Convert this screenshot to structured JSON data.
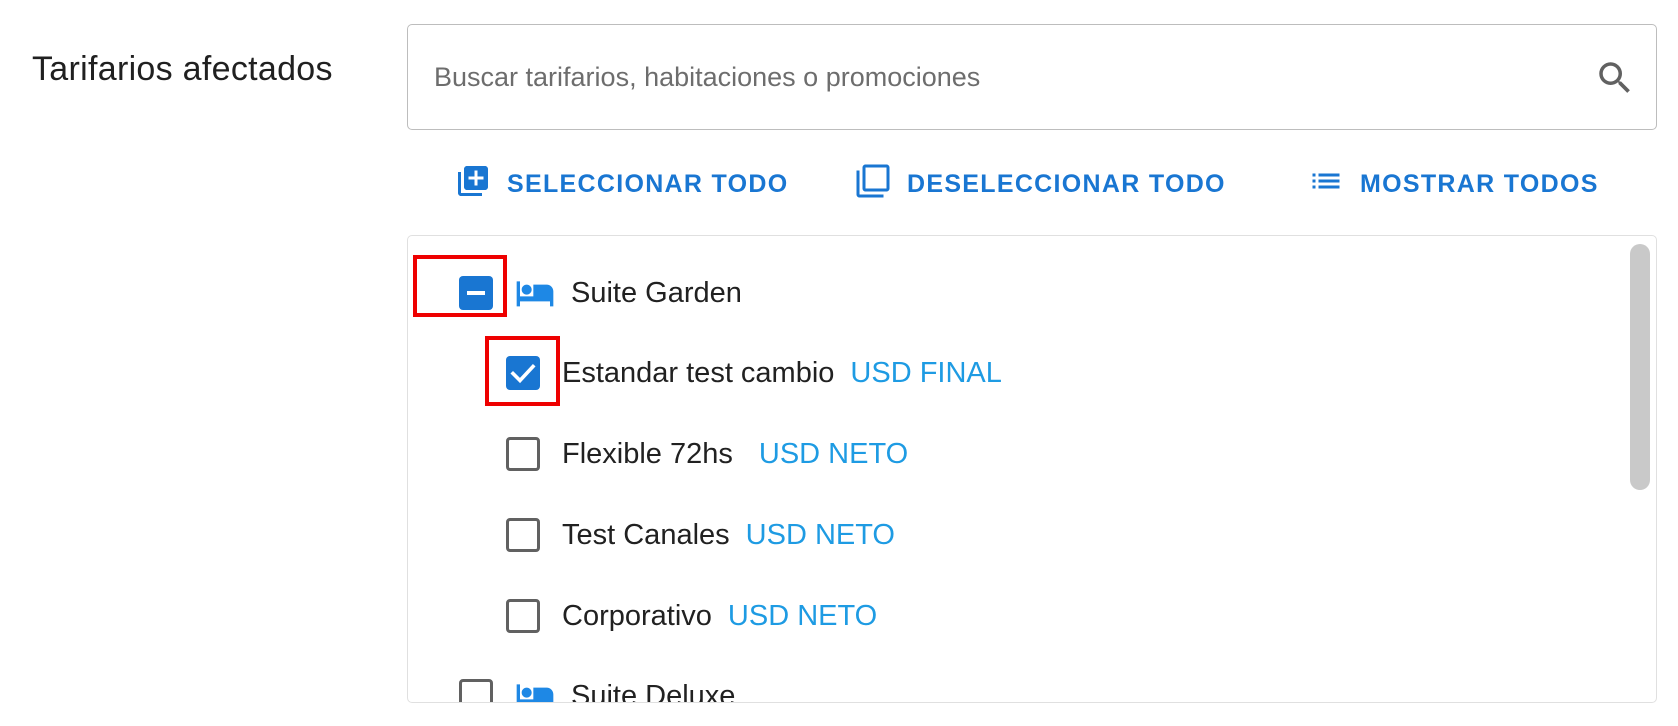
{
  "section": {
    "label": "Tarifarios afectados"
  },
  "search": {
    "placeholder": "Buscar tarifarios, habitaciones o promociones",
    "value": "",
    "icon": "search-icon"
  },
  "actions": {
    "select_all": {
      "label": "SELECCIONAR TODO",
      "icon": "library-add-icon"
    },
    "deselect_all": {
      "label": "DESELECCIONAR TODO",
      "icon": "filter-none-icon"
    },
    "show_all": {
      "label": "MOSTRAR TODOS",
      "icon": "list-icon"
    }
  },
  "colors": {
    "accent": "#1976d2",
    "tag": "#1e9be3",
    "highlight": "#ee0000"
  },
  "rooms": [
    {
      "name": "Suite Garden",
      "icon": "bed-icon",
      "state": "indeterminate",
      "rates": [
        {
          "name": "Estandar test cambio",
          "tag": "USD FINAL",
          "checked": true
        },
        {
          "name": "Flexible 72hs",
          "tag": "USD NETO",
          "checked": false
        },
        {
          "name": "Test Canales",
          "tag": "USD NETO",
          "checked": false
        },
        {
          "name": "Corporativo",
          "tag": "USD NETO",
          "checked": false
        }
      ]
    },
    {
      "name": "Suite Deluxe",
      "icon": "bed-icon",
      "state": "unchecked",
      "rates": []
    }
  ]
}
